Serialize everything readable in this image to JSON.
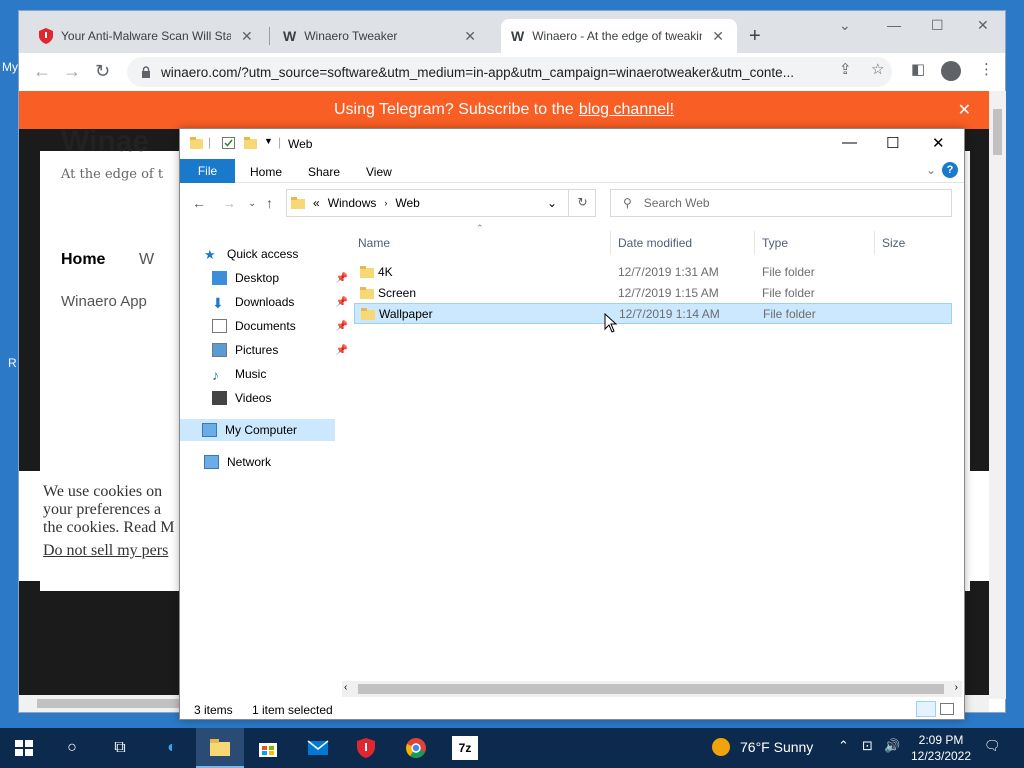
{
  "desktop": {
    "labels": [
      "My",
      "R"
    ]
  },
  "browser": {
    "tabs": [
      {
        "title": "Your Anti-Malware Scan Will Start",
        "icon": "shield-icon"
      },
      {
        "title": "Winaero Tweaker",
        "icon": "winaero-logo-icon"
      },
      {
        "title": "Winaero - At the edge of tweaking",
        "icon": "winaero-logo-icon"
      }
    ],
    "url": "winaero.com/?utm_source=software&utm_medium=in-app&utm_campaign=winaerotweaker&utm_conte...",
    "banner": {
      "text": "Using Telegram? Subscribe to the",
      "link": "blog channel!"
    },
    "page": {
      "site_title": "Winae",
      "tagline": "At the edge of t",
      "nav_home": "Home",
      "nav_w": "W",
      "apps": "Winaero App",
      "cookie_lines": [
        "We use cookies on",
        "your preferences a",
        "the cookies. Read M",
        "Do not sell my pers"
      ]
    }
  },
  "explorer": {
    "title": "Web",
    "ribbon_tabs": [
      "File",
      "Home",
      "Share",
      "View"
    ],
    "address": {
      "prefix": "«",
      "parts": [
        "Windows",
        "Web"
      ]
    },
    "search_placeholder": "Search Web",
    "nav": {
      "quick_access": "Quick access",
      "items": [
        {
          "label": "Desktop",
          "icon": "desktop-icon",
          "pinned": true
        },
        {
          "label": "Downloads",
          "icon": "download-icon",
          "pinned": true
        },
        {
          "label": "Documents",
          "icon": "documents-icon",
          "pinned": true
        },
        {
          "label": "Pictures",
          "icon": "pictures-icon",
          "pinned": true
        },
        {
          "label": "Music",
          "icon": "music-icon",
          "pinned": false
        },
        {
          "label": "Videos",
          "icon": "videos-icon",
          "pinned": false
        }
      ],
      "my_computer": "My Computer",
      "network": "Network"
    },
    "columns": [
      "Name",
      "Date modified",
      "Type",
      "Size"
    ],
    "rows": [
      {
        "name": "4K",
        "date": "12/7/2019 1:31 AM",
        "type": "File folder"
      },
      {
        "name": "Screen",
        "date": "12/7/2019 1:15 AM",
        "type": "File folder"
      },
      {
        "name": "Wallpaper",
        "date": "12/7/2019 1:14 AM",
        "type": "File folder"
      }
    ],
    "status": {
      "items": "3 items",
      "selected": "1 item selected"
    }
  },
  "taskbar": {
    "weather": "76°F  Sunny",
    "time": "2:09 PM",
    "date": "12/23/2022"
  },
  "colors": {
    "banner": "#f95e24",
    "accent": "#1979ca",
    "selection": "#cce8ff",
    "taskbar": "#0c2a4d"
  }
}
